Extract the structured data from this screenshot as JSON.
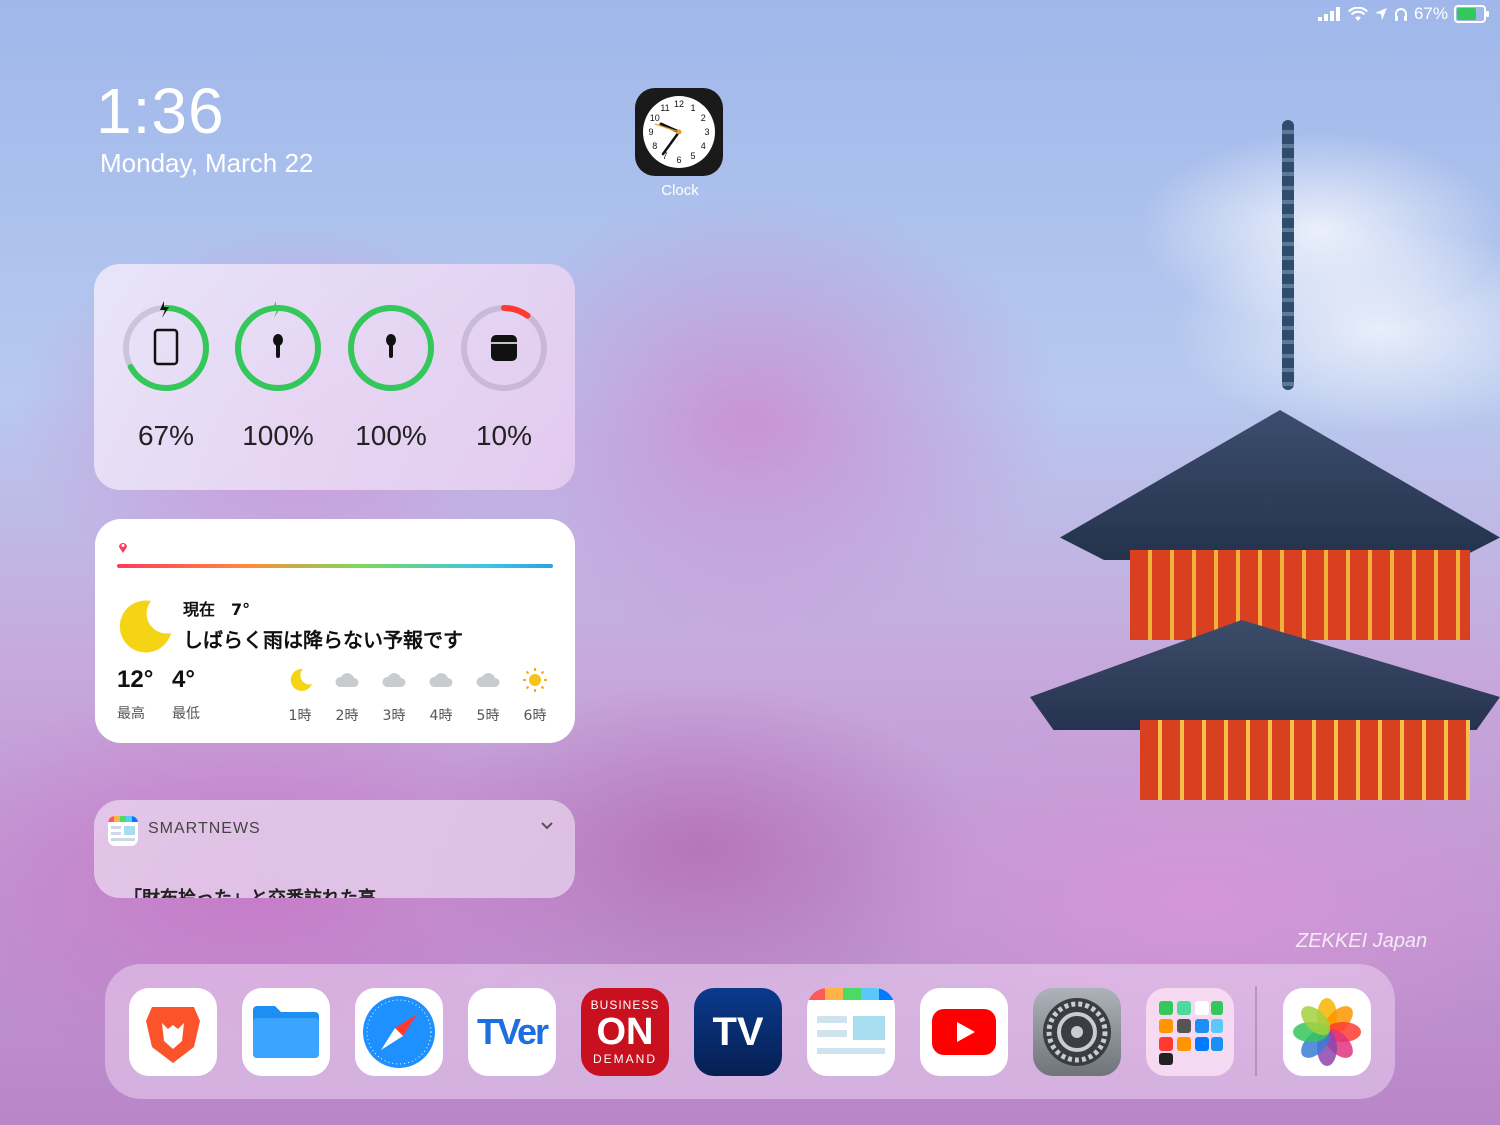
{
  "status_bar": {
    "battery_text": "67%",
    "battery_level": 0.67
  },
  "lock": {
    "time": "1:36",
    "date": "Monday, March 22"
  },
  "clock_app": {
    "label": "Clock",
    "hour_numbers": [
      "12",
      "1",
      "2",
      "3",
      "4",
      "5",
      "6",
      "7",
      "8",
      "9",
      "10",
      "11"
    ]
  },
  "battery_widget": {
    "items": [
      {
        "name": "ipad",
        "percent": "67%",
        "level": 0.67,
        "charging": true,
        "color": "#34c759"
      },
      {
        "name": "airpod-left",
        "percent": "100%",
        "level": 1.0,
        "charging": true,
        "color": "#34c759"
      },
      {
        "name": "airpod-right",
        "percent": "100%",
        "level": 1.0,
        "charging": false,
        "color": "#34c759"
      },
      {
        "name": "airpods-case",
        "percent": "10%",
        "level": 0.1,
        "charging": false,
        "color": "#ff3b30"
      }
    ]
  },
  "weather_widget": {
    "now": "現在　7°",
    "forecast": "しばらく雨は降らない予報です",
    "high": "12°",
    "low": "4°",
    "high_label": "最高",
    "low_label": "最低",
    "hours": [
      {
        "label": "1時",
        "icon": "moon"
      },
      {
        "label": "2時",
        "icon": "cloud"
      },
      {
        "label": "3時",
        "icon": "cloud"
      },
      {
        "label": "4時",
        "icon": "cloud"
      },
      {
        "label": "5時",
        "icon": "cloud"
      },
      {
        "label": "6時",
        "icon": "sun"
      }
    ]
  },
  "news_widget": {
    "title": "SMARTNEWS",
    "headline": "「財布拾った」と交番訪れた高"
  },
  "watermark": "ZEKKEI Japan",
  "dock": {
    "apps": [
      {
        "name": "brave"
      },
      {
        "name": "files"
      },
      {
        "name": "safari"
      },
      {
        "name": "tver",
        "text": "TVer"
      },
      {
        "name": "business-on-demand",
        "text_top": "BUSINESS",
        "text_mid": "ON",
        "text_bottom": "DEMAND"
      },
      {
        "name": "tv",
        "text": "TV"
      },
      {
        "name": "news-reader"
      },
      {
        "name": "youtube"
      },
      {
        "name": "settings"
      },
      {
        "name": "folder"
      },
      {
        "name": "photos"
      }
    ]
  }
}
